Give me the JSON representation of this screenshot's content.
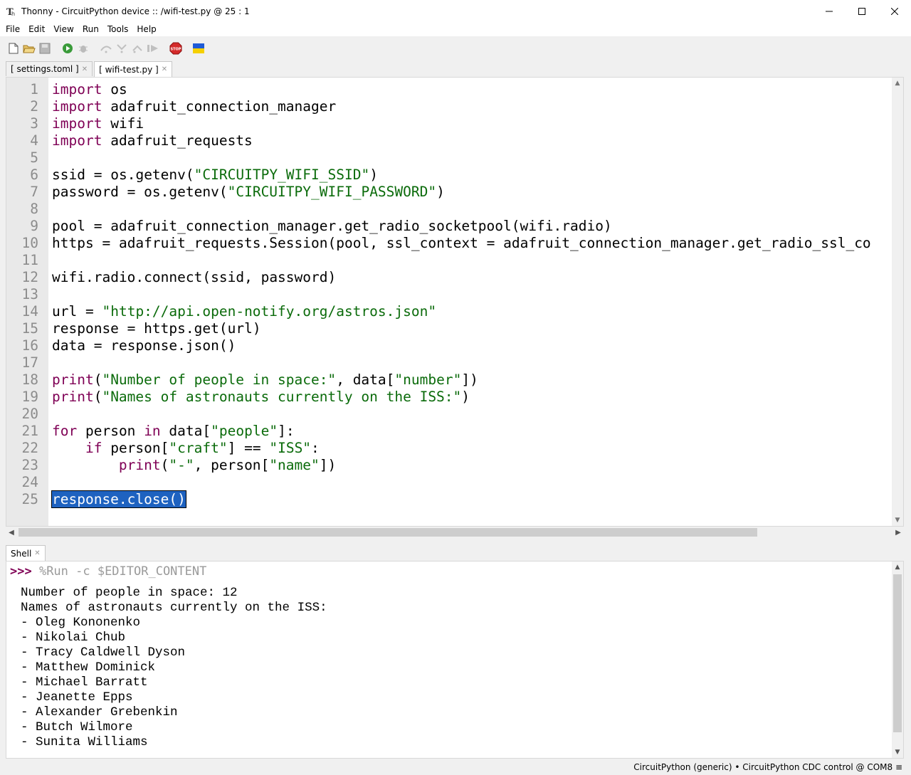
{
  "window": {
    "title": "Thonny  -  CircuitPython device :: /wifi-test.py  @  25 : 1"
  },
  "menu": [
    "File",
    "Edit",
    "View",
    "Run",
    "Tools",
    "Help"
  ],
  "tabs": [
    {
      "label": "[ settings.toml ]",
      "active": false
    },
    {
      "label": "[ wifi-test.py ]",
      "active": true
    }
  ],
  "editor": {
    "line_numbers": [
      "1",
      "2",
      "3",
      "4",
      "5",
      "6",
      "7",
      "8",
      "9",
      "10",
      "11",
      "12",
      "13",
      "14",
      "15",
      "16",
      "17",
      "18",
      "19",
      "20",
      "21",
      "22",
      "23",
      "24",
      "25"
    ],
    "lines": [
      "import os",
      "import adafruit_connection_manager",
      "import wifi",
      "import adafruit_requests",
      "",
      "ssid = os.getenv(\"CIRCUITPY_WIFI_SSID\")",
      "password = os.getenv(\"CIRCUITPY_WIFI_PASSWORD\")",
      "",
      "pool = adafruit_connection_manager.get_radio_socketpool(wifi.radio)",
      "https = adafruit_requests.Session(pool, ssl_context = adafruit_connection_manager.get_radio_ssl_co",
      "",
      "wifi.radio.connect(ssid, password)",
      "",
      "url = \"http://api.open-notify.org/astros.json\"",
      "response = https.get(url)",
      "data = response.json()",
      "",
      "print(\"Number of people in space:\", data[\"number\"])",
      "print(\"Names of astronauts currently on the ISS:\")",
      "",
      "for person in data[\"people\"]:",
      "    if person[\"craft\"] == \"ISS\":",
      "        print(\"-\", person[\"name\"])",
      "",
      "response.close()"
    ],
    "selected_text": "response.close()"
  },
  "shell": {
    "tab_label": "Shell",
    "prompt": ">>> ",
    "command": "%Run -c $EDITOR_CONTENT",
    "output": [
      "Number of people in space: 12",
      "Names of astronauts currently on the ISS:",
      "- Oleg Kononenko",
      "- Nikolai Chub",
      "- Tracy Caldwell Dyson",
      "- Matthew Dominick",
      "- Michael Barratt",
      "- Jeanette Epps",
      "- Alexander Grebenkin",
      "- Butch Wilmore",
      "- Sunita Williams"
    ]
  },
  "status": "CircuitPython (generic)  •  CircuitPython CDC control @ COM8  ≡",
  "colors": {
    "keyword": "#7f0055",
    "string": "#0b6b0b",
    "selection": "#1e62c0",
    "gutter": "#e9e9e9"
  }
}
